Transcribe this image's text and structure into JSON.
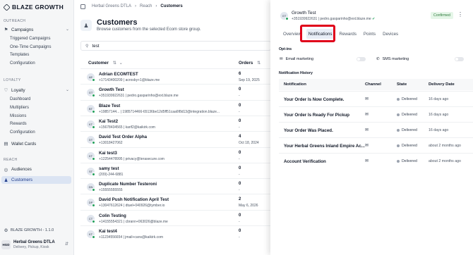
{
  "brand": {
    "name": "BLAZE GROWTH"
  },
  "sidebar": {
    "sections": [
      {
        "label": "OUTREACH"
      },
      {
        "label": "LOYALTY"
      },
      {
        "label": "REACH"
      }
    ],
    "campaigns": {
      "label": "Campaigns",
      "children": [
        "Triggered Campaigns",
        "One-Time Campaigns",
        "Templates",
        "Configuration"
      ]
    },
    "loyalty": {
      "label": "Loyalty",
      "children": [
        "Dashboard",
        "Multipliers",
        "Missions",
        "Rewards",
        "Configuration"
      ]
    },
    "wallet_cards": "Wallet Cards",
    "audiences": "Audiences",
    "customers": "Customers",
    "version": "BLAZE GROWTH - 1.1.0",
    "store": {
      "badge": "HGD",
      "name": "Herbal Greens DTLA",
      "sub": "Delivery, Pickup, Kiosk"
    }
  },
  "breadcrumb": {
    "items": [
      "Herbal Greens DTLA",
      "Reach",
      "Customers"
    ]
  },
  "page": {
    "title": "Customers",
    "subtitle": "Browse customers from the selected Ecom store group.",
    "search_value": "test"
  },
  "table": {
    "headers": {
      "customer": "Customer",
      "orders": "Orders"
    },
    "rows": [
      {
        "initials": "AE",
        "name": "Adrian ECOMTEST",
        "contact": "+17143400209  |  acrosby+1@blaze.me",
        "orders": "6",
        "date": "Sep 19, 2025"
      },
      {
        "initials": "GT",
        "name": "Growth Test",
        "contact": "+351939922631  |  pedro.gasparinho@ext.blaze.me",
        "orders": "0",
        "date": "-"
      },
      {
        "initials": "BT",
        "name": "Blaze Test",
        "contact": "+19857144...  |  1985714466-65136be12d5ff51caa6f8d13@integration.blaze...",
        "orders": "0",
        "date": "-"
      },
      {
        "initials": "KT",
        "name": "Kai Test2",
        "contact": "+15678434565  |  karif2@kaikirk.com",
        "orders": "0",
        "date": "-"
      },
      {
        "initials": "DT",
        "name": "David Test Order Alpha",
        "contact": "+13018427062",
        "orders": "4",
        "date": "Oct 18, 2024"
      },
      {
        "initials": "KT",
        "name": "Kai test3",
        "contact": "+12254478995  |  privacy@terasecure.com",
        "orders": "0",
        "date": "-"
      },
      {
        "initials": "ST",
        "name": "samy test",
        "contact": "(209)-244-6881",
        "orders": "0",
        "date": "-"
      },
      {
        "initials": "DN",
        "name": "Duplicate Number Testeroni",
        "contact": "+15555555555",
        "orders": "0",
        "date": "-"
      },
      {
        "initials": "DP",
        "name": "David Push Notification April Test",
        "contact": "+13047612624  |  dtuel+040926@tymber.io",
        "orders": "2",
        "date": "May 6, 2026"
      },
      {
        "initials": "CT",
        "name": "Colin Testing",
        "contact": "+14155554321  |  cbrann+063026@blaze.me",
        "orders": "0",
        "date": "-"
      },
      {
        "initials": "KT",
        "name": "Kai test4",
        "contact": "+11234556654  |  jmail+cans@kaikirk.com",
        "orders": "0",
        "date": "-"
      }
    ]
  },
  "drawer": {
    "initials": "GT",
    "name": "Growth Test",
    "contact": "+351939922631  |  pedro.gasparinho@ext.blaze.me",
    "status": "Confirmed",
    "tabs": [
      "Overview",
      "Notifications",
      "Rewards",
      "Points",
      "Devices"
    ],
    "active_tab": "Notifications",
    "optins_title": "Opt-ins",
    "email_marketing": "Email marketing",
    "sms_marketing": "SMS marketing",
    "history_title": "Notification History",
    "history_headers": {
      "notification": "Notification",
      "channel": "Channel",
      "state": "State",
      "delivery_date": "Delivery Date"
    },
    "history": [
      {
        "title": "Your Order Is Now Complete.",
        "state": "Delivered",
        "date": "16 days ago"
      },
      {
        "title": "Your Order Is Ready For Pickup",
        "state": "Delivered",
        "date": "16 days ago"
      },
      {
        "title": "Your Order Was Placed.",
        "state": "Delivered",
        "date": "16 days ago"
      },
      {
        "title": "Your Herbal Greens Inland Empire Ac...",
        "state": "Delivered",
        "date": "about 2 months ago"
      },
      {
        "title": "Account Verification",
        "state": "Delivered",
        "date": "about 2 months ago"
      }
    ]
  },
  "colors": {
    "accent": "#dbe4f3",
    "success": "#22a05a",
    "highlight": "#e0001a"
  }
}
